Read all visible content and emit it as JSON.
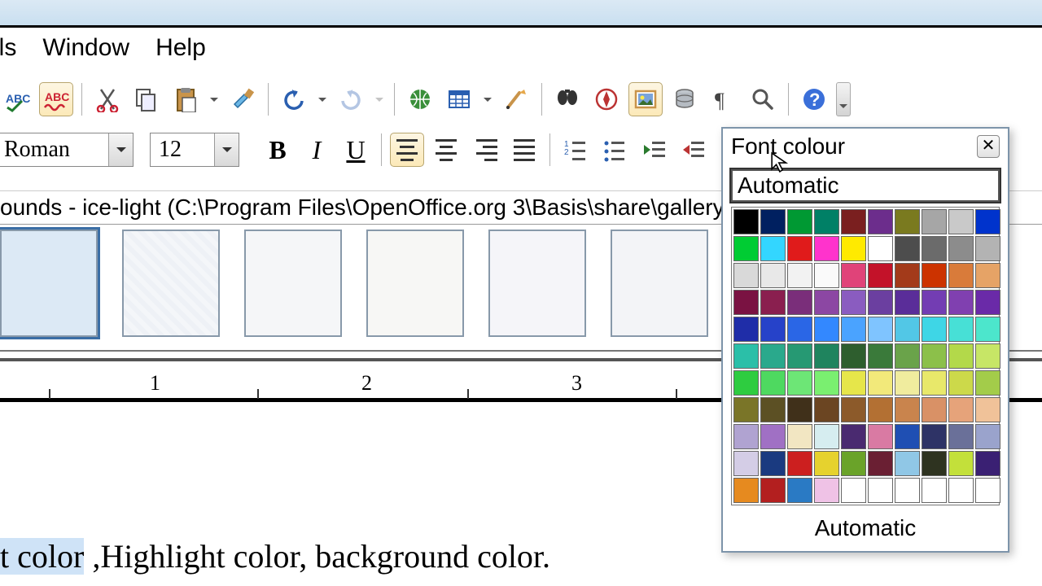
{
  "menubar": {
    "tools": "ols",
    "window": "Window",
    "help": "Help"
  },
  "toolbar1_icons": {
    "spellcheck": "spellcheck-icon",
    "autospell": "autospell-icon",
    "cut": "cut-icon",
    "copy": "copy-icon",
    "paste": "paste-icon",
    "format_paint": "format-paintbrush-icon",
    "undo": "undo-icon",
    "redo": "redo-icon",
    "hyperlink": "hyperlink-icon",
    "table": "table-icon",
    "draw": "draw-icon",
    "find": "find-replace-icon",
    "navigator": "navigator-icon",
    "gallery": "gallery-icon",
    "datasources": "data-sources-icon",
    "nonprint": "nonprinting-chars-icon",
    "zoom": "zoom-icon",
    "helpbtn": "help-icon"
  },
  "formatbar": {
    "font_name": "Roman",
    "font_size": "12",
    "bold": "B",
    "italic": "I",
    "underline": "U"
  },
  "gallery_path": "ounds - ice-light (C:\\Program Files\\OpenOffice.org 3\\Basis\\share\\gallery\\www-back",
  "ruler": {
    "r1": "1",
    "r2": "2",
    "r3": "3"
  },
  "doc_text": {
    "selected": "t color",
    "rest": " ,Highlight color, background color."
  },
  "font_colour": {
    "title": "Font colour",
    "automatic_top": "Automatic",
    "automatic_bottom": "Automatic",
    "swatches": [
      "#000000",
      "#002060",
      "#009933",
      "#008066",
      "#7a1f1f",
      "#6c2d8c",
      "#7a7a1f",
      "#a6a6a6",
      "#c9c9c9",
      "#0033cc",
      "#00cc33",
      "#33d6ff",
      "#e01b1b",
      "#ff33cc",
      "#ffea00",
      "#ffffff",
      "#4d4d4d",
      "#6b6b6b",
      "#8c8c8c",
      "#b3b3b3",
      "#d9d9d9",
      "#e8e8e8",
      "#f2f2f2",
      "#fafafa",
      "#e04379",
      "#c31229",
      "#a33a1a",
      "#cc3300",
      "#d97b3a",
      "#e6a366",
      "#7a1242",
      "#8a1f4f",
      "#7a2e7a",
      "#8c47a3",
      "#8a5cc0",
      "#6b3fa0",
      "#5a2d99",
      "#733db3",
      "#8040b0",
      "#6a2aa8",
      "#1f2da8",
      "#2642c9",
      "#2a66e6",
      "#3388ff",
      "#4aa3ff",
      "#7fc4ff",
      "#52c7e6",
      "#3ed6e6",
      "#47e0d6",
      "#4ce6cc",
      "#2bbfa8",
      "#2aa98c",
      "#269973",
      "#1f845e",
      "#2e5e2e",
      "#3a7a3a",
      "#6aa34a",
      "#8cc04a",
      "#b3d94a",
      "#c7e666",
      "#2ecc40",
      "#4ed960",
      "#6de676",
      "#7aef70",
      "#e6e64a",
      "#f2e97a",
      "#f0ec9e",
      "#e8e86a",
      "#ccd94a",
      "#a3cc4a",
      "#7a7528",
      "#5c5024",
      "#40301a",
      "#6b4522",
      "#8c5a2a",
      "#b37033",
      "#c9844d",
      "#d99166",
      "#e6a37a",
      "#f0c299",
      "#b0a3d1",
      "#a070c4",
      "#f2e6c2",
      "#d6edf0",
      "#4a2a70",
      "#d97aa3",
      "#1f4fb3",
      "#2e3366",
      "#6a7099",
      "#9aa3cc",
      "#d4cde6",
      "#1a3a80",
      "#cc1f1f",
      "#e6d22e",
      "#6aa329",
      "#6a1f33",
      "#90c7e6",
      "#2e3320",
      "#c3e03a",
      "#3a2073",
      "#e68a1f",
      "#b31f1f",
      "#2a7ac4",
      "#efc2e6",
      "#ffffff",
      "#ffffff",
      "#ffffff",
      "#ffffff",
      "#ffffff",
      "#ffffff"
    ]
  }
}
